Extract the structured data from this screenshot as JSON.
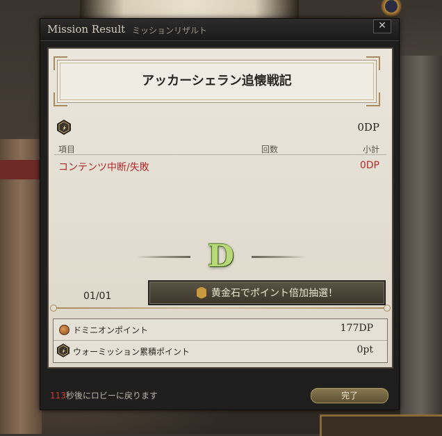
{
  "window": {
    "title_en": "Mission Result",
    "title_jp": "ミッションリザルト",
    "close_label": "✕"
  },
  "mission": {
    "name": "アッカーシェラン追懐戦記",
    "total_dp": "0DP"
  },
  "table": {
    "headers": [
      "項目",
      "回数",
      "小計"
    ],
    "rows": [
      {
        "label": "コンテンツ中断/失敗",
        "count": "",
        "subtotal": "0DP"
      }
    ]
  },
  "grade": "D",
  "pagination": "01/01",
  "lottery_button_label": "黄金石でポイント倍加抽選！",
  "points": [
    {
      "label": "ドミニオンポイント",
      "value": "177DP",
      "icon": "coin-icon"
    },
    {
      "label": "ウォーミッション累積ポイント",
      "value": "0pt",
      "icon": "war-emblem-icon"
    }
  ],
  "footer": {
    "countdown": "113",
    "message": "秒後にロビーに戻ります",
    "done_label": "完了"
  },
  "colors": {
    "penalty_red": "#b22b2b",
    "grade_green": "#b9d87a",
    "countdown_red": "#d23a2a"
  }
}
